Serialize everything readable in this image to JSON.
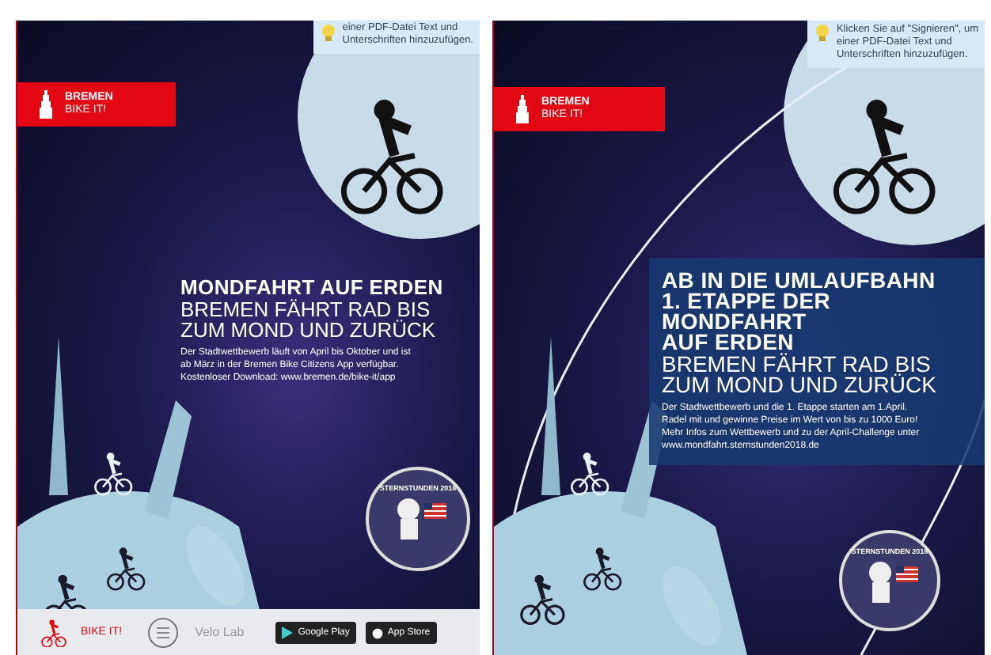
{
  "posters": [
    {
      "tooltip": {
        "lines": [
          "einer PDF-Datei Text und",
          "Unterschriften hinzuzufügen."
        ]
      },
      "logo": {
        "title": "BREMEN",
        "subtitle": "BIKE IT!"
      },
      "orbit": false,
      "text_panel": false,
      "headline": [
        "MONDFAHRT AUF ERDEN"
      ],
      "subline": [
        "BREMEN FÄHRT RAD BIS",
        "ZUM MOND UND ZURÜCK"
      ],
      "body": [
        "Der Stadtwettbewerb läuft von April bis Oktober und ist",
        "ab März in der Bremen Bike Citizens App verfügbar.",
        "Kostenloser Download: www.bremen.de/bike-it/app"
      ],
      "badge": "STERNSTUNDEN 2018",
      "footer": {
        "brand": "BIKE IT!",
        "partner": "Velo Lab",
        "stores": [
          "Google Play",
          "App Store"
        ]
      }
    },
    {
      "tooltip": {
        "lines": [
          "Klicken Sie auf \"Signieren\", um",
          "einer PDF-Datei Text und",
          "Unterschriften hinzuzufügen."
        ]
      },
      "logo": {
        "title": "BREMEN",
        "subtitle": "BIKE IT!"
      },
      "orbit": true,
      "text_panel": true,
      "headline": [
        "AB IN DIE UMLAUFBAHN",
        "1. ETAPPE DER MONDFAHRT",
        "AUF ERDEN"
      ],
      "subline": [
        "BREMEN FÄHRT RAD BIS",
        "ZUM MOND UND ZURÜCK"
      ],
      "body": [
        "Der Stadtwettbewerb und die 1. Etappe starten am 1.April.",
        "Radel mit und gewinne Preise im Wert von bis zu 1000 Euro!",
        "Mehr Infos zum Wettbewerb und zu der April-Challenge unter",
        "www.mondfahrt.sternstunden2018.de"
      ],
      "badge": "STERNSTUNDEN 2018"
    }
  ]
}
